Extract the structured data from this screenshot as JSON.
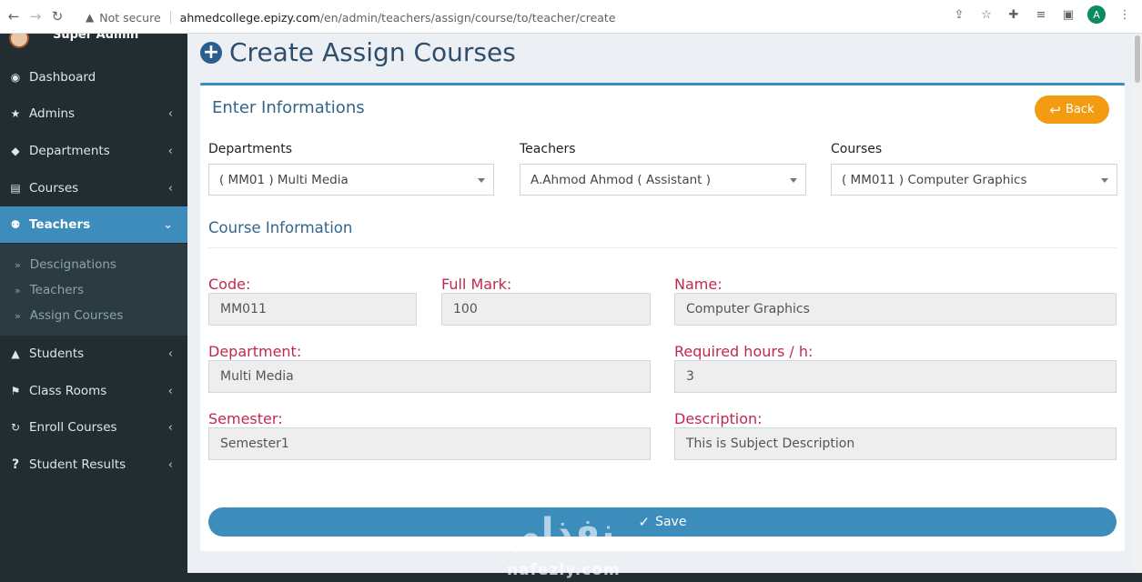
{
  "browser": {
    "security": "Not secure",
    "url_host": "ahmedcollege.epizy.com",
    "url_path": "/en/admin/teachers/assign/course/to/teacher/create",
    "profile_initial": "A"
  },
  "sidebar": {
    "user_name": "Super Admin",
    "items": [
      {
        "label": "Dashboard",
        "icon": "dashboard-icon",
        "glyph": "◉"
      },
      {
        "label": "Admins",
        "icon": "star-icon",
        "glyph": "★"
      },
      {
        "label": "Departments",
        "icon": "tags-icon",
        "glyph": "◆"
      },
      {
        "label": "Courses",
        "icon": "book-icon",
        "glyph": "▤"
      },
      {
        "label": "Teachers",
        "icon": "user-plus-icon",
        "glyph": "⚉"
      },
      {
        "label": "Students",
        "icon": "graduation-cap-icon",
        "glyph": "▲"
      },
      {
        "label": "Class Rooms",
        "icon": "flag-icon",
        "glyph": "⚑"
      },
      {
        "label": "Enroll Courses",
        "icon": "refresh-icon",
        "glyph": "↻"
      },
      {
        "label": "Student Results",
        "icon": "question-icon",
        "glyph": "?"
      }
    ],
    "submenu": [
      {
        "label": "Descignations"
      },
      {
        "label": "Teachers"
      },
      {
        "label": "Assign Courses"
      }
    ]
  },
  "page": {
    "title": "Create Assign Courses"
  },
  "form": {
    "box_title": "Enter Informations",
    "back_label": "Back",
    "departments_label": "Departments",
    "departments_value": "( MM01 ) Multi Media",
    "teachers_label": "Teachers",
    "teachers_value": "A.Ahmod Ahmod ( Assistant )",
    "courses_label": "Courses",
    "courses_value": "( MM011 ) Computer Graphics",
    "section_title": "Course Information",
    "code_label": "Code:",
    "code_value": "MM011",
    "fullmark_label": "Full Mark:",
    "fullmark_value": "100",
    "name_label": "Name:",
    "name_value": "Computer Graphics",
    "department_label": "Department:",
    "department_value": "Multi Media",
    "hours_label": "Required hours / h:",
    "hours_value": "3",
    "semester_label": "Semester:",
    "semester_value": "Semester1",
    "description_label": "Description:",
    "description_value": "This is Subject Description",
    "save_label": "Save"
  },
  "watermark": {
    "text": "نفذلي",
    "sub": "nafezly.com"
  },
  "colors": {
    "sidebar_bg": "#222d32",
    "active_bg": "#3c8dbc",
    "label_red": "#c0294f",
    "back_orange": "#f39c12"
  }
}
